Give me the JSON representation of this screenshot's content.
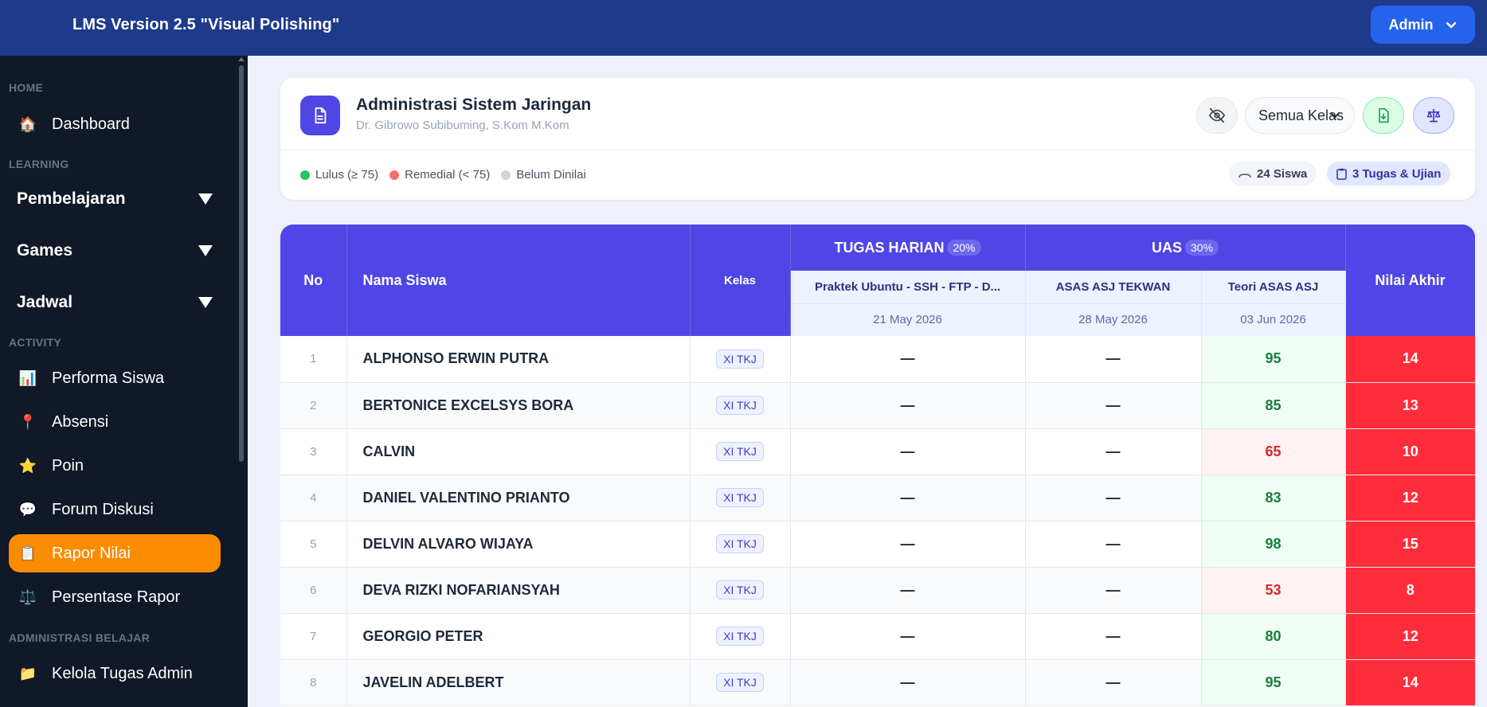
{
  "header": {
    "app_title": "LMS Version 2.5 \"Visual Polishing\"",
    "admin_label": "Admin"
  },
  "sidebar": {
    "sections": {
      "home": "HOME",
      "learning": "LEARNING",
      "activity": "ACTIVITY",
      "admin": "ADMINISTRASI BELAJAR"
    },
    "dashboard": {
      "label": "Dashboard",
      "icon": "🏠"
    },
    "groups": [
      "Pembelajaran",
      "Games",
      "Jadwal"
    ],
    "activity_items": [
      {
        "label": "Performa Siswa",
        "icon": "📊"
      },
      {
        "label": "Absensi",
        "icon": "📍"
      },
      {
        "label": "Poin",
        "icon": "⭐"
      },
      {
        "label": "Forum Diskusi",
        "icon": "💬"
      },
      {
        "label": "Rapor Nilai",
        "icon": "📋"
      },
      {
        "label": "Persentase Rapor",
        "icon": "⚖️"
      }
    ],
    "admin_items": [
      {
        "label": "Kelola Tugas Admin",
        "icon": "📁"
      }
    ],
    "active_color": "#fb8c00"
  },
  "course": {
    "title": "Administrasi Sistem Jaringan",
    "teacher": "Dr. Gibrowo Subibuming, S.Kom M.Kom",
    "class_filter": "Semua Kelas",
    "legend": [
      {
        "label": "Lulus (≥ 75)",
        "color": "#22c55e"
      },
      {
        "label": "Remedial (< 75)",
        "color": "#f87171"
      },
      {
        "label": "Belum Dinilai",
        "color": "#d1d5db"
      }
    ],
    "student_count": "24 Siswa",
    "task_count": "3 Tugas & Ujian"
  },
  "table": {
    "headers": {
      "no": "No",
      "name": "Nama Siswa",
      "kelas": "Kelas",
      "final": "Nilai Akhir"
    },
    "groups": [
      {
        "label": "TUGAS HARIAN",
        "weight": "20%"
      },
      {
        "label": "UAS",
        "weight": "30%"
      }
    ],
    "assignments": [
      {
        "title": "Praktek Ubuntu - SSH - FTP - D...",
        "date": "21 May 2026"
      },
      {
        "title": "ASAS ASJ TEKWAN",
        "date": "28 May 2026"
      },
      {
        "title": "Teori ASAS ASJ",
        "date": "03 Jun 2026"
      }
    ],
    "rows": [
      {
        "no": "1",
        "name": "ALPHONSO ERWIN PUTRA",
        "kelas": "XI TKJ",
        "a1": "—",
        "a2": "—",
        "a3": "95",
        "final": "14"
      },
      {
        "no": "2",
        "name": "BERTONICE EXCELSYS BORA",
        "kelas": "XI TKJ",
        "a1": "—",
        "a2": "—",
        "a3": "85",
        "final": "13"
      },
      {
        "no": "3",
        "name": "CALVIN",
        "kelas": "XI TKJ",
        "a1": "—",
        "a2": "—",
        "a3": "65",
        "final": "10"
      },
      {
        "no": "4",
        "name": "DANIEL VALENTINO PRIANTO",
        "kelas": "XI TKJ",
        "a1": "—",
        "a2": "—",
        "a3": "83",
        "final": "12"
      },
      {
        "no": "5",
        "name": "DELVIN ALVARO WIJAYA",
        "kelas": "XI TKJ",
        "a1": "—",
        "a2": "—",
        "a3": "98",
        "final": "15"
      },
      {
        "no": "6",
        "name": "DEVA RIZKI NOFARIANSYAH",
        "kelas": "XI TKJ",
        "a1": "—",
        "a2": "—",
        "a3": "53",
        "final": "8"
      },
      {
        "no": "7",
        "name": "GEORGIO PETER",
        "kelas": "XI TKJ",
        "a1": "—",
        "a2": "—",
        "a3": "80",
        "final": "12"
      },
      {
        "no": "8",
        "name": "JAVELIN ADELBERT",
        "kelas": "XI TKJ",
        "a1": "—",
        "a2": "—",
        "a3": "95",
        "final": "14"
      }
    ],
    "colors": {
      "header": "#4f46e5",
      "pass": "#15803d",
      "fail": "#dc2626",
      "final_bg": "#ff2d3b"
    }
  }
}
